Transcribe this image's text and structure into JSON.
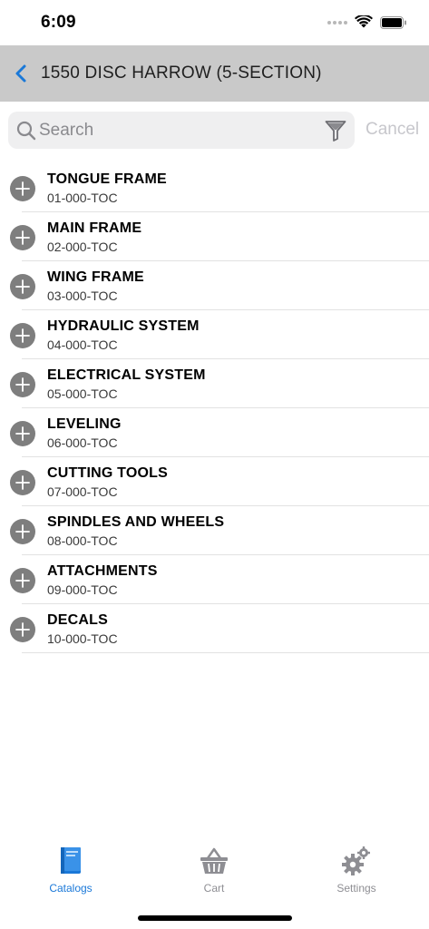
{
  "status": {
    "time": "6:09"
  },
  "nav": {
    "title": "1550 DISC HARROW (5-SECTION)"
  },
  "search": {
    "placeholder": "Search",
    "cancel_label": "Cancel"
  },
  "items": [
    {
      "title": "TONGUE FRAME",
      "code": "01-000-TOC"
    },
    {
      "title": "MAIN FRAME",
      "code": "02-000-TOC"
    },
    {
      "title": "WING FRAME",
      "code": "03-000-TOC"
    },
    {
      "title": "HYDRAULIC SYSTEM",
      "code": "04-000-TOC"
    },
    {
      "title": "ELECTRICAL SYSTEM",
      "code": "05-000-TOC"
    },
    {
      "title": "LEVELING",
      "code": "06-000-TOC"
    },
    {
      "title": "CUTTING TOOLS",
      "code": "07-000-TOC"
    },
    {
      "title": "SPINDLES AND WHEELS",
      "code": "08-000-TOC"
    },
    {
      "title": "ATTACHMENTS",
      "code": "09-000-TOC"
    },
    {
      "title": "DECALS",
      "code": "10-000-TOC"
    }
  ],
  "tabs": [
    {
      "label": "Catalogs",
      "icon": "catalog-book-icon",
      "active": true
    },
    {
      "label": "Cart",
      "icon": "basket-icon",
      "active": false
    },
    {
      "label": "Settings",
      "icon": "gears-icon",
      "active": false
    }
  ],
  "colors": {
    "accent": "#1a78d8",
    "nav_background": "#c9c9c9",
    "add_icon": "#7e7e7e",
    "tab_inactive": "#8e8e93"
  }
}
